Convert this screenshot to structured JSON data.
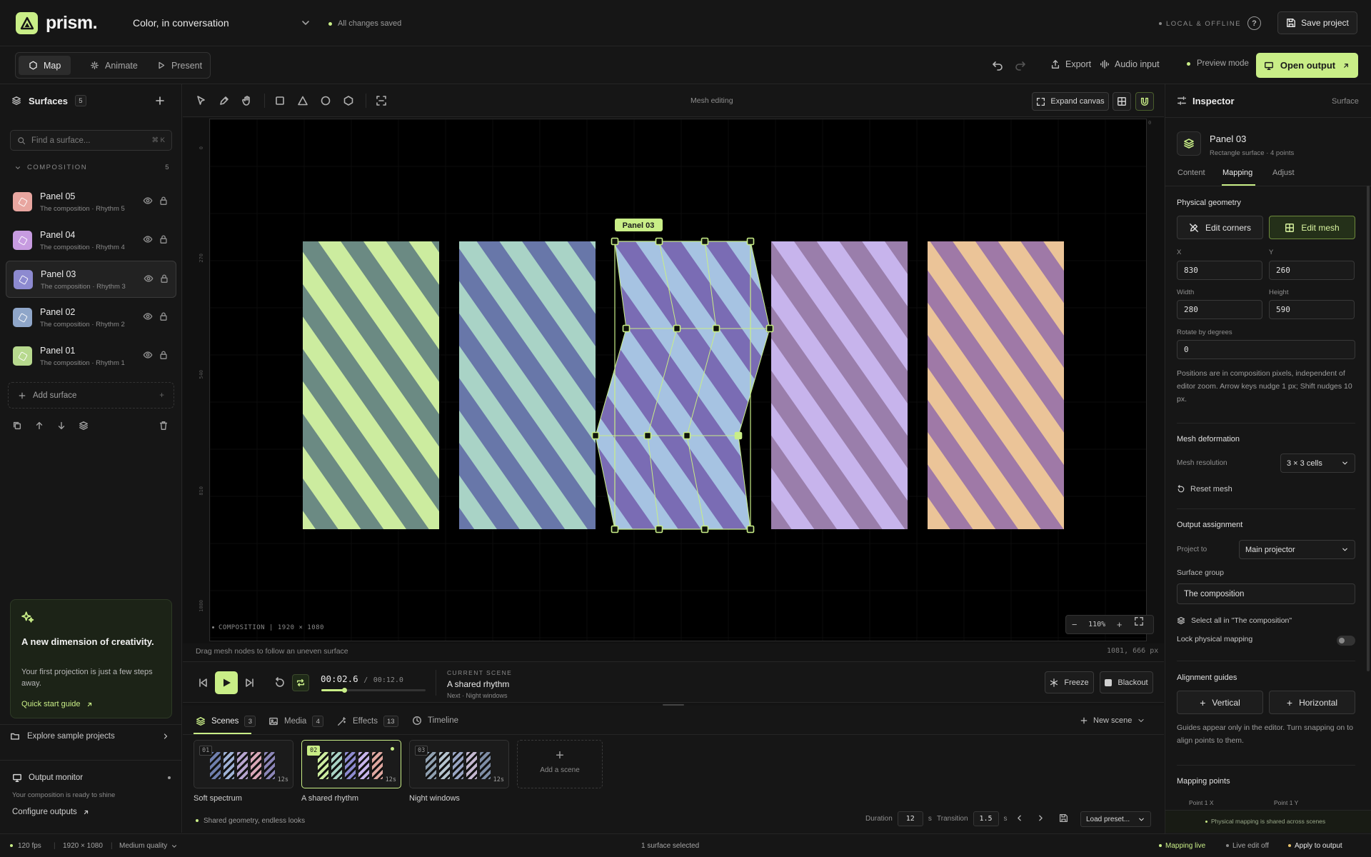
{
  "app": {
    "name": "prism.",
    "project": "Color, in conversation",
    "save_state": "All changes saved",
    "connection": "LOCAL & OFFLINE",
    "save_label": "Save project",
    "help": "?"
  },
  "modes": [
    {
      "label": "Map",
      "active": true
    },
    {
      "label": "Animate",
      "active": false
    },
    {
      "label": "Present",
      "active": false
    }
  ],
  "toolbar": {
    "export": "Export",
    "audio": "Audio input",
    "preview": "Preview mode",
    "open_output": "Open output"
  },
  "surfaces": {
    "title": "Surfaces",
    "count": "5",
    "search_placeholder": "Find a surface...",
    "search_shortcut": "⌘ K",
    "group": "COMPOSITION",
    "group_count": "5",
    "items": [
      {
        "name": "Panel 05",
        "sub": "The composition · Rhythm 5",
        "color": "#e8a6a0",
        "selected": false
      },
      {
        "name": "Panel 04",
        "sub": "The composition · Rhythm 4",
        "color": "#c79be0",
        "selected": false
      },
      {
        "name": "Panel 03",
        "sub": "The composition · Rhythm 3",
        "color": "#8d8ad0",
        "selected": true
      },
      {
        "name": "Panel 02",
        "sub": "The composition · Rhythm 2",
        "color": "#8fa6c9",
        "selected": false
      },
      {
        "name": "Panel 01",
        "sub": "The composition · Rhythm 1",
        "color": "#b7d98e",
        "selected": false
      }
    ],
    "add_label": "Add surface"
  },
  "promo": {
    "title": "A new dimension of creativity.",
    "body": "Your first projection is just a few steps away.",
    "link": "Quick start guide"
  },
  "explore": "Explore sample projects",
  "monitor": {
    "title": "Output monitor",
    "status": "Your composition is ready to shine",
    "configure": "Configure outputs"
  },
  "canvas": {
    "mode_label": "Mesh editing",
    "expand": "Expand canvas",
    "ruler_v": [
      "0",
      "270",
      "540",
      "810",
      "1080"
    ],
    "ruler_h_end": "0",
    "composition_label": "COMPOSITION | 1920 × 1080",
    "zoom": "110%",
    "hint": "Drag mesh nodes to follow an uneven surface",
    "coords": "1081, 666 px",
    "selected_tag": "Panel 03",
    "panels": [
      {
        "name": "Panel 01",
        "a": "#ccec9f",
        "b": "#6b8a83"
      },
      {
        "name": "Panel 02",
        "a": "#a9d3c6",
        "b": "#6877a9"
      },
      {
        "name": "Panel 03",
        "a": "#a6c3e2",
        "b": "#7a6cb4"
      },
      {
        "name": "Panel 04",
        "a": "#c7b4ec",
        "b": "#9a7eab"
      },
      {
        "name": "Panel 05",
        "a": "#ebc498",
        "b": "#9f79a7"
      }
    ]
  },
  "transport": {
    "time": "00:02.6",
    "separator": "/",
    "total": "00:12.0",
    "progress": 0.22,
    "current_label": "CURRENT SCENE",
    "current_name": "A shared rhythm",
    "next": "Next · Night windows",
    "freeze": "Freeze",
    "blackout": "Blackout"
  },
  "dock": {
    "tabs": [
      {
        "label": "Scenes",
        "count": "3"
      },
      {
        "label": "Media",
        "count": "4"
      },
      {
        "label": "Effects",
        "count": "13"
      },
      {
        "label": "Timeline",
        "count": ""
      }
    ],
    "new_scene": "New scene",
    "scenes": [
      {
        "num": "01",
        "name": "Soft spectrum",
        "dur": "12s",
        "colors": [
          "#6f7fae",
          "#9fb2d6",
          "#b7a5cf",
          "#d9a8b8",
          "#8c86b8"
        ]
      },
      {
        "num": "02",
        "name": "A shared rhythm",
        "dur": "12s",
        "colors": [
          "#ccec9f",
          "#a9d3c6",
          "#8d8ad0",
          "#c7b4ec",
          "#e0a7a0"
        ]
      },
      {
        "num": "03",
        "name": "Night windows",
        "dur": "12s",
        "colors": [
          "#8fa0b0",
          "#b5c4cf",
          "#9aa6c4",
          "#c4b8d0",
          "#7f8ea6"
        ]
      }
    ],
    "add_scene": "Add a scene",
    "shared": "Shared geometry, endless looks",
    "duration_label": "Duration",
    "duration": "12",
    "unit": "s",
    "transition_label": "Transition",
    "transition": "1.5",
    "load_preset": "Load preset..."
  },
  "status": {
    "fps": "120 fps",
    "res": "1920 × 1080",
    "quality": "Medium quality",
    "selection": "1 surface selected",
    "mapping_live": "Mapping live",
    "live_edit": "Live edit off",
    "apply": "Apply to output"
  },
  "inspector": {
    "title": "Inspector",
    "kind": "Surface",
    "name": "Panel 03",
    "sub": "Rectangle surface · 4 points",
    "tabs": [
      "Content",
      "Mapping",
      "Adjust"
    ],
    "active_tab": "Mapping",
    "geometry": {
      "title": "Physical geometry",
      "edit_corners": "Edit corners",
      "edit_mesh": "Edit mesh",
      "x_label": "X",
      "x": "830",
      "y_label": "Y",
      "y": "260",
      "w_label": "Width",
      "w": "280",
      "h_label": "Height",
      "h": "590",
      "rot_label": "Rotate by degrees",
      "rot": "0",
      "note": "Positions are in composition pixels, independent of editor zoom. Arrow keys nudge 1 px; Shift nudges 10 px."
    },
    "mesh": {
      "title": "Mesh deformation",
      "res_label": "Mesh resolution",
      "res": "3 × 3 cells",
      "reset": "Reset mesh"
    },
    "output": {
      "title": "Output assignment",
      "project_label": "Project to",
      "project": "Main projector",
      "group_label": "Surface group",
      "group": "The composition",
      "select_all": "Select all in \"The composition\"",
      "lock": "Lock physical mapping",
      "lock_on": false
    },
    "guides": {
      "title": "Alignment guides",
      "vertical": "Vertical",
      "horizontal": "Horizontal",
      "note": "Guides appear only in the editor. Turn snapping on to align points to them."
    },
    "points": {
      "title": "Mapping points",
      "col1": "Point 1 X",
      "col2": "Point 1 Y"
    },
    "footer": "Physical mapping is shared across scenes"
  },
  "accent": "#c9ee87"
}
